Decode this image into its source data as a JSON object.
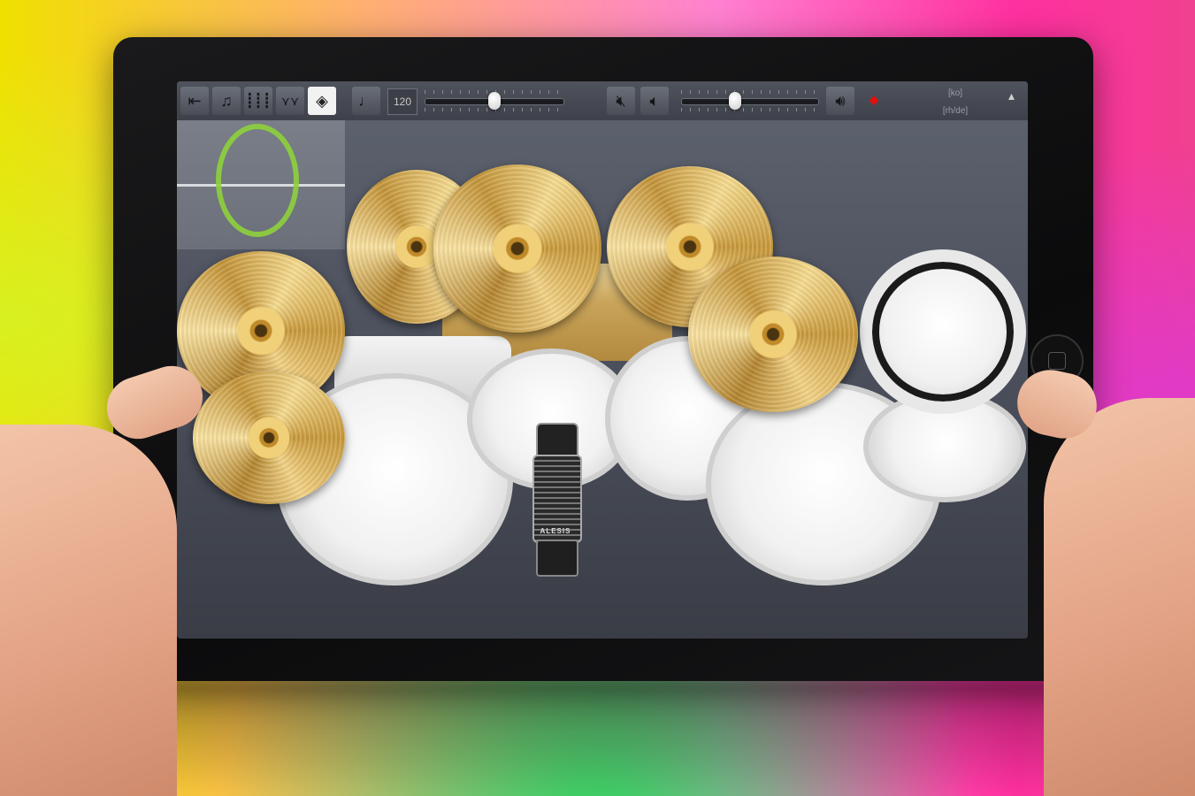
{
  "app": {
    "toolbar": {
      "buttons": [
        {
          "name": "exit-button",
          "icon": "exit-icon",
          "glyph": "⇤"
        },
        {
          "name": "instrument-button",
          "icon": "drum-hit-icon",
          "glyph": "♪"
        },
        {
          "name": "mixer-button",
          "icon": "mixer-icon",
          "glyph": "⫶"
        },
        {
          "name": "effects-button",
          "icon": "effects-icon",
          "glyph": "⋎"
        },
        {
          "name": "sound-wave-button",
          "icon": "sound-wave-icon",
          "glyph": "◈"
        },
        {
          "name": "metronome-button",
          "icon": "metronome-icon",
          "glyph": "♩"
        }
      ],
      "tempo_value": "120",
      "tempo_slider_fraction": 0.5,
      "mute_button_icon": "speaker-muted-icon",
      "volume_down_icon": "speaker-low-icon",
      "volume_slider_fraction": 0.38,
      "volume_up_icon": "speaker-high-icon",
      "record_icon": "record-icon",
      "label_top": "[ko]",
      "label_bottom": "[rh/de]",
      "menu_icon": "menu-icon"
    },
    "colors": {
      "accent_active": "#f2f2f2",
      "record_red": "#e01010",
      "ring_green": "#8ed23c"
    },
    "pedal_brand": "ALESIS"
  }
}
